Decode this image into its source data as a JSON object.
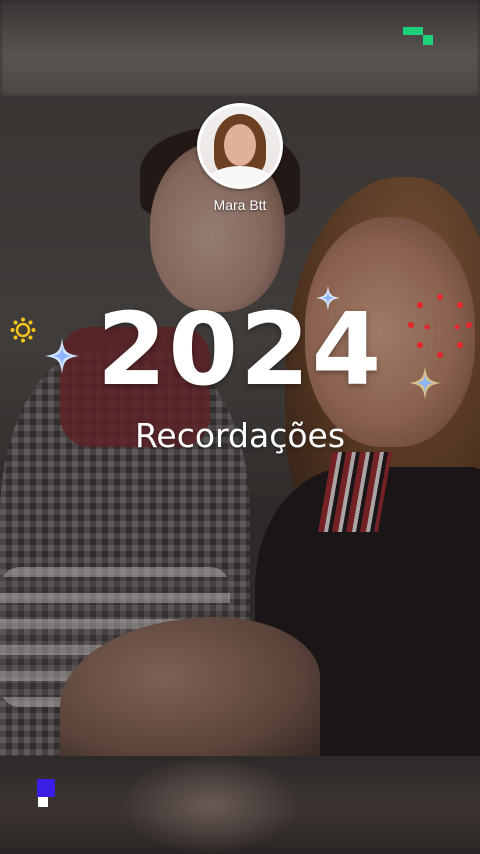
{
  "story": {
    "author_name": "Mara Btt",
    "year_headline": "2024",
    "subtitle": "Recordações"
  },
  "colors": {
    "brand_green": "#1fd07a",
    "brand_blue": "#3b1fe6",
    "sparkle_blue": "#cfe3ff",
    "sun_yellow": "#f2c21b",
    "dots_red": "#e3262b",
    "text_white": "#ffffff"
  },
  "icons": {
    "top_right": "brand-pixel-icon",
    "bottom_left": "brand-pixel-icon",
    "decorations": [
      "sparkle-icon",
      "sun-icon",
      "dots-circle-icon"
    ]
  }
}
